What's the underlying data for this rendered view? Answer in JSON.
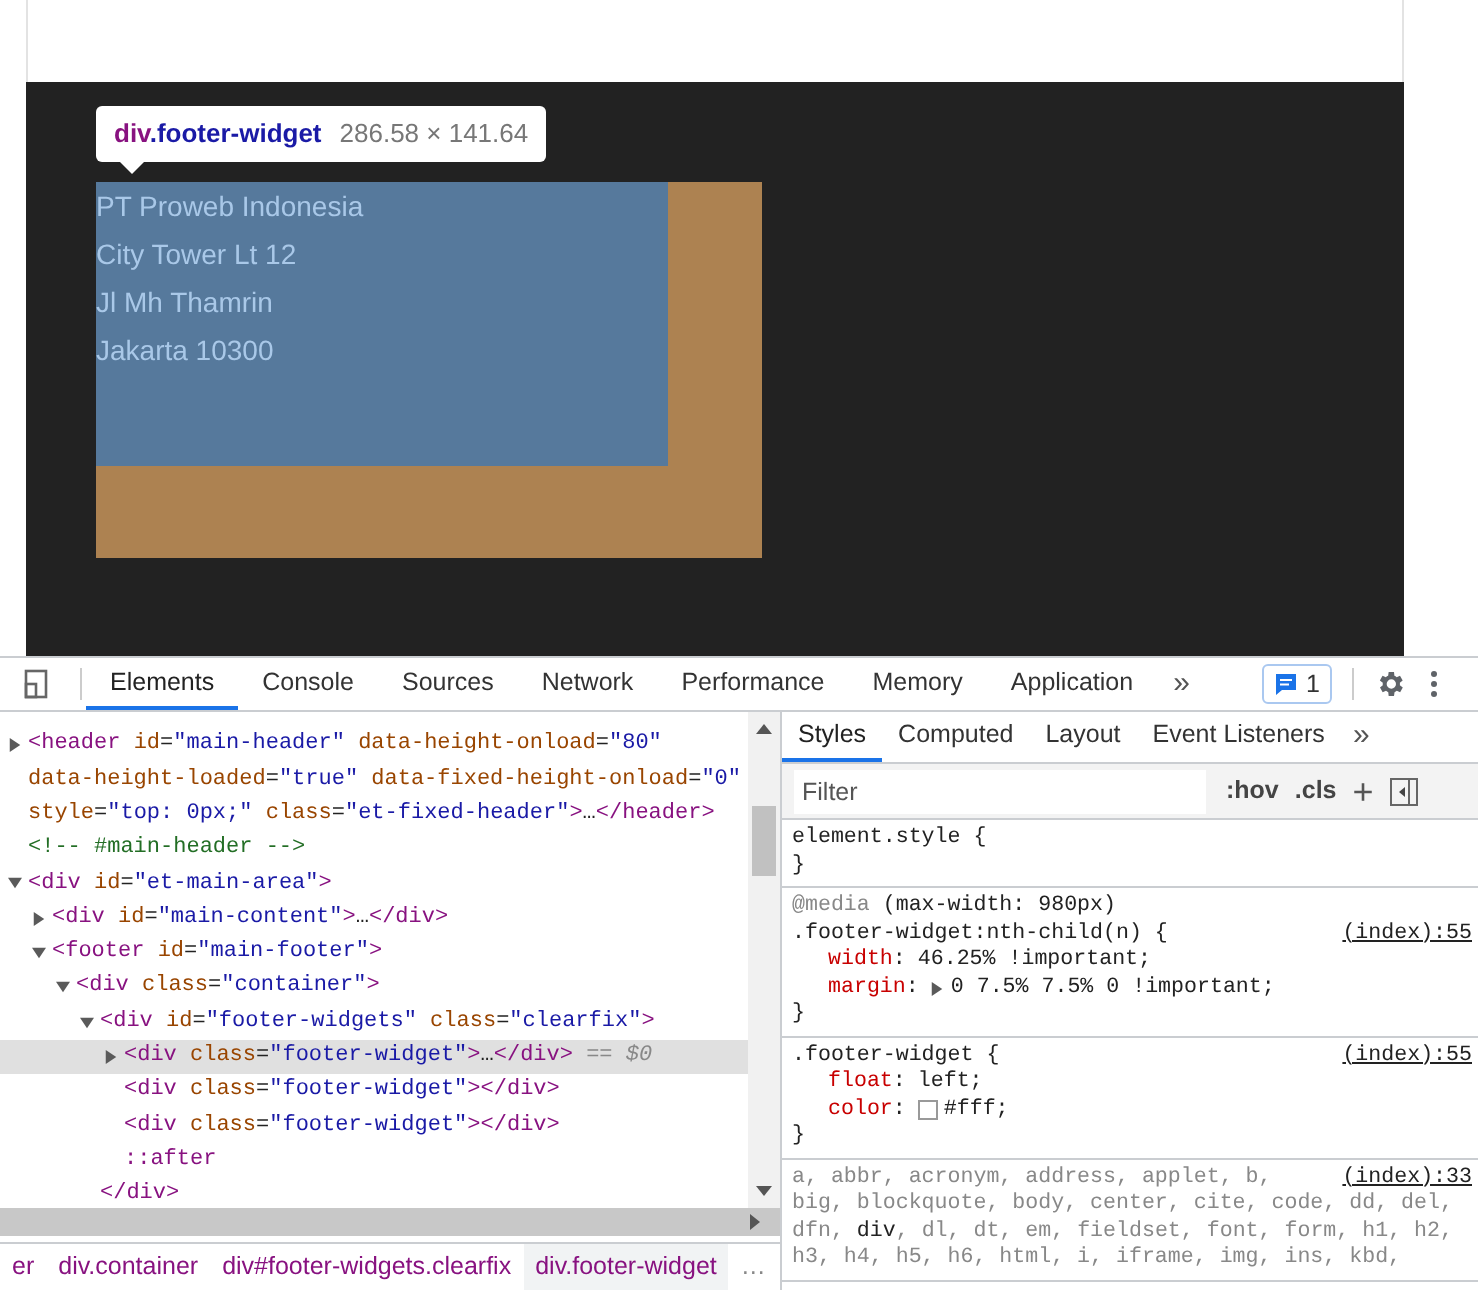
{
  "page": {
    "tooltip": {
      "tag": "div",
      "class": ".footer-widget",
      "size": "286.58 × 141.64"
    },
    "widget_lines": [
      "PT Proweb Indonesia",
      "City Tower Lt 12",
      "Jl Mh Thamrin",
      "Jakarta 10300"
    ]
  },
  "devtools": {
    "tabs": [
      {
        "label": "Elements",
        "selected": true
      },
      {
        "label": "Console",
        "selected": false
      },
      {
        "label": "Sources",
        "selected": false
      },
      {
        "label": "Network",
        "selected": false
      },
      {
        "label": "Performance",
        "selected": false
      },
      {
        "label": "Memory",
        "selected": false
      },
      {
        "label": "Application",
        "selected": false
      }
    ],
    "more": "»",
    "issues_count": "1"
  },
  "tree": [
    {
      "kind": "branch",
      "expanded": false,
      "selected": false,
      "lines": [
        [
          {
            "kind": "tag",
            "s": "<header"
          },
          {
            "kind": "attr",
            "s": " id"
          },
          {
            "kind": "plain",
            "s": "="
          },
          {
            "kind": "val",
            "s": "\"main-header\""
          },
          {
            "kind": "attr",
            "s": " data-height-onload"
          },
          {
            "kind": "plain",
            "s": "="
          },
          {
            "kind": "val",
            "s": "\"80\""
          }
        ],
        [
          {
            "kind": "attr",
            "s": "data-height-loaded"
          },
          {
            "kind": "plain",
            "s": "="
          },
          {
            "kind": "val",
            "s": "\"true\""
          },
          {
            "kind": "attr",
            "s": " data-fixed-height-onload"
          },
          {
            "kind": "plain",
            "s": "="
          },
          {
            "kind": "val",
            "s": "\"0\""
          }
        ],
        [
          {
            "kind": "attr",
            "s": "style"
          },
          {
            "kind": "plain",
            "s": "="
          },
          {
            "kind": "val",
            "s": "\"top: 0px;\""
          },
          {
            "kind": "attr",
            "s": " class"
          },
          {
            "kind": "plain",
            "s": "="
          },
          {
            "kind": "val",
            "s": "\"et-fixed-header\""
          },
          {
            "kind": "tag",
            "s": ">"
          },
          {
            "kind": "plain",
            "s": "…"
          },
          {
            "kind": "tag",
            "s": "</header>"
          }
        ]
      ]
    },
    {
      "kind": "leaf",
      "selected": false,
      "lines": [
        [
          {
            "kind": "comment",
            "s": "<!-- #main-header -->"
          }
        ]
      ]
    },
    {
      "kind": "branch",
      "expanded": true,
      "selected": false,
      "lines": [
        [
          {
            "kind": "tag",
            "s": "<div"
          },
          {
            "kind": "attr",
            "s": " id"
          },
          {
            "kind": "plain",
            "s": "="
          },
          {
            "kind": "val",
            "s": "\"et-main-area\""
          },
          {
            "kind": "tag",
            "s": ">"
          }
        ]
      ],
      "children": [
        {
          "kind": "branch",
          "expanded": false,
          "selected": false,
          "lines": [
            [
              {
                "kind": "tag",
                "s": "<div"
              },
              {
                "kind": "attr",
                "s": " id"
              },
              {
                "kind": "plain",
                "s": "="
              },
              {
                "kind": "val",
                "s": "\"main-content\""
              },
              {
                "kind": "tag",
                "s": ">"
              },
              {
                "kind": "plain",
                "s": "…"
              },
              {
                "kind": "tag",
                "s": "</div>"
              }
            ]
          ]
        },
        {
          "kind": "branch",
          "expanded": true,
          "selected": false,
          "lines": [
            [
              {
                "kind": "tag",
                "s": "<footer"
              },
              {
                "kind": "attr",
                "s": " id"
              },
              {
                "kind": "plain",
                "s": "="
              },
              {
                "kind": "val",
                "s": "\"main-footer\""
              },
              {
                "kind": "tag",
                "s": ">"
              }
            ]
          ],
          "children": [
            {
              "kind": "branch",
              "expanded": true,
              "selected": false,
              "lines": [
                [
                  {
                    "kind": "tag",
                    "s": "<div"
                  },
                  {
                    "kind": "attr",
                    "s": " class"
                  },
                  {
                    "kind": "plain",
                    "s": "="
                  },
                  {
                    "kind": "val",
                    "s": "\"container\""
                  },
                  {
                    "kind": "tag",
                    "s": ">"
                  }
                ]
              ],
              "children": [
                {
                  "kind": "branch",
                  "expanded": true,
                  "selected": false,
                  "lines": [
                    [
                      {
                        "kind": "tag",
                        "s": "<div"
                      },
                      {
                        "kind": "attr",
                        "s": " id"
                      },
                      {
                        "kind": "plain",
                        "s": "="
                      },
                      {
                        "kind": "val",
                        "s": "\"footer-widgets\""
                      },
                      {
                        "kind": "attr",
                        "s": " class"
                      },
                      {
                        "kind": "plain",
                        "s": "="
                      },
                      {
                        "kind": "val",
                        "s": "\"clearfix\""
                      },
                      {
                        "kind": "tag",
                        "s": ">"
                      }
                    ]
                  ],
                  "children": [
                    {
                      "kind": "branch",
                      "expanded": false,
                      "selected": true,
                      "lines": [
                        [
                          {
                            "kind": "tag",
                            "s": "<div"
                          },
                          {
                            "kind": "attr",
                            "s": " class"
                          },
                          {
                            "kind": "plain",
                            "s": "="
                          },
                          {
                            "kind": "val",
                            "s": "\"footer-widget\""
                          },
                          {
                            "kind": "tag",
                            "s": ">"
                          },
                          {
                            "kind": "plain",
                            "s": "…"
                          },
                          {
                            "kind": "tag",
                            "s": "</div>"
                          },
                          {
                            "kind": "dim",
                            "s": " == $0"
                          }
                        ]
                      ]
                    },
                    {
                      "kind": "leaf",
                      "selected": false,
                      "lines": [
                        [
                          {
                            "kind": "tag",
                            "s": "<div"
                          },
                          {
                            "kind": "attr",
                            "s": " class"
                          },
                          {
                            "kind": "plain",
                            "s": "="
                          },
                          {
                            "kind": "val",
                            "s": "\"footer-widget\""
                          },
                          {
                            "kind": "tag",
                            "s": ">"
                          },
                          {
                            "kind": "tag",
                            "s": "</div>"
                          }
                        ]
                      ]
                    },
                    {
                      "kind": "leaf",
                      "selected": false,
                      "lines": [
                        [
                          {
                            "kind": "tag",
                            "s": "<div"
                          },
                          {
                            "kind": "attr",
                            "s": " class"
                          },
                          {
                            "kind": "plain",
                            "s": "="
                          },
                          {
                            "kind": "val",
                            "s": "\"footer-widget\""
                          },
                          {
                            "kind": "tag",
                            "s": ">"
                          },
                          {
                            "kind": "tag",
                            "s": "</div>"
                          }
                        ]
                      ]
                    },
                    {
                      "kind": "leaf",
                      "selected": false,
                      "lines": [
                        [
                          {
                            "kind": "tag",
                            "s": "::after"
                          }
                        ]
                      ]
                    }
                  ]
                },
                {
                  "kind": "leaf",
                  "selected": false,
                  "lines": [
                    [
                      {
                        "kind": "tag",
                        "s": "</div>"
                      }
                    ]
                  ]
                }
              ]
            }
          ]
        }
      ]
    }
  ],
  "breadcrumbs": [
    {
      "label": "er",
      "selected": false
    },
    {
      "label": "div.container",
      "selected": false
    },
    {
      "label": "div#footer-widgets.clearfix",
      "selected": false
    },
    {
      "label": "div.footer-widget",
      "selected": true
    }
  ],
  "breadcrumbs_more": "…",
  "styles": {
    "tabs": [
      {
        "label": "Styles",
        "selected": true
      },
      {
        "label": "Computed",
        "selected": false
      },
      {
        "label": "Layout",
        "selected": false
      },
      {
        "label": "Event Listeners",
        "selected": false
      }
    ],
    "more": "»",
    "filter": {
      "placeholder": "Filter"
    },
    "hov": ":hov",
    "cls": ".cls",
    "add": "+",
    "rules": [
      {
        "selector": [
          [
            {
              "s": "element.style {",
              "matched": true
            }
          ]
        ],
        "close": "}"
      },
      {
        "media": [
          {
            "s": "@media",
            "matched": false
          },
          {
            "s": " (max-width: 980px)",
            "matched": true
          }
        ],
        "selector": [
          [
            {
              "s": ".footer-widget:nth-child(n) {",
              "matched": true
            }
          ]
        ],
        "source": "(index):55",
        "declarations": [
          {
            "kind": "plain",
            "name": "width",
            "separator": ":",
            "value": "46.25% !important;"
          },
          {
            "kind": "shorthand",
            "expanded": false,
            "name": "margin",
            "separator": ":",
            "value": "0 7.5% 7.5% 0 !important;"
          }
        ],
        "close": "}"
      },
      {
        "selector": [
          [
            {
              "s": ".footer-widget {",
              "matched": true
            }
          ]
        ],
        "source": "(index):55",
        "declarations": [
          {
            "kind": "plain",
            "name": "float",
            "separator": ":",
            "value": "left;"
          },
          {
            "kind": "color",
            "color": "#ffffff",
            "name": "color",
            "separator": ":",
            "value": "#fff;"
          }
        ],
        "close": "}"
      },
      {
        "selector": [
          [
            {
              "s": "a, abbr, acronym, address, applet, b,",
              "matched": false
            }
          ],
          [
            {
              "s": "big, blockquote, body, center, cite, code, dd, del,",
              "matched": false
            }
          ],
          [
            {
              "s": "dfn, ",
              "matched": false
            },
            {
              "s": "div",
              "matched": true
            },
            {
              "s": ", dl, dt, em, fieldset, font, form, h1, h2,",
              "matched": false
            }
          ],
          [
            {
              "s": "h3, h4, h5, h6, html, i, iframe, img, ins, kbd,",
              "matched": false
            }
          ]
        ],
        "source": "(index):33"
      }
    ]
  }
}
